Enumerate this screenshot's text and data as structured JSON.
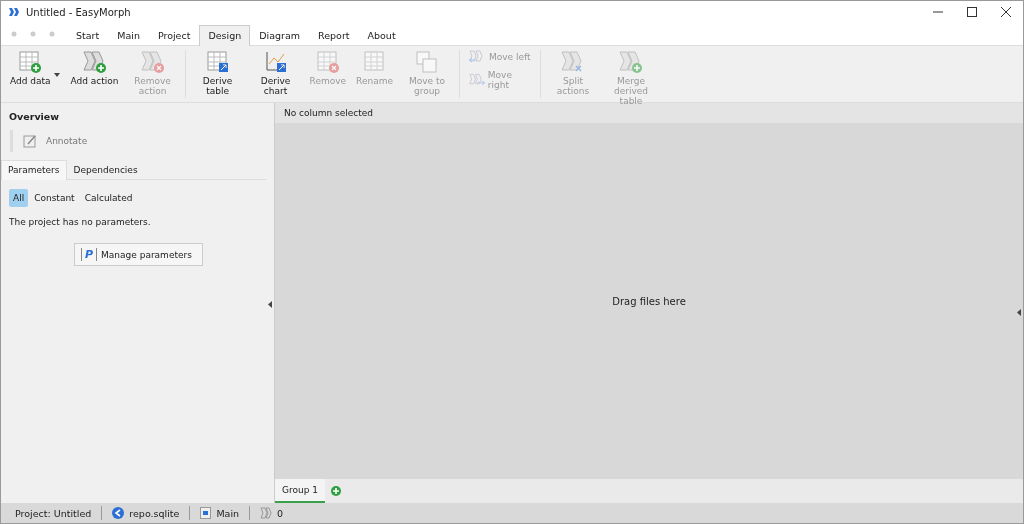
{
  "window": {
    "title": "Untitled - EasyMorph"
  },
  "menu_tabs": [
    {
      "label": "Start",
      "selected": false
    },
    {
      "label": "Main",
      "selected": false
    },
    {
      "label": "Project",
      "selected": false
    },
    {
      "label": "Design",
      "selected": true
    },
    {
      "label": "Diagram",
      "selected": false
    },
    {
      "label": "Report",
      "selected": false
    },
    {
      "label": "About",
      "selected": false
    }
  ],
  "ribbon": [
    {
      "buttons": [
        {
          "kind": "split",
          "label": "Add data",
          "disabled": false
        },
        {
          "kind": "large",
          "label": "Add action",
          "disabled": false
        },
        {
          "kind": "large",
          "label": "Remove action",
          "disabled": true
        }
      ]
    },
    {
      "buttons": [
        {
          "kind": "large",
          "label": "Derive table",
          "disabled": false
        },
        {
          "kind": "large",
          "label": "Derive chart",
          "disabled": false
        },
        {
          "kind": "large",
          "label": "Remove",
          "disabled": true
        },
        {
          "kind": "large",
          "label": "Rename",
          "disabled": true
        },
        {
          "kind": "large",
          "label": "Move to group",
          "disabled": true
        }
      ]
    },
    {
      "buttons": [
        {
          "kind": "small",
          "label": "Move left",
          "disabled": true
        },
        {
          "kind": "small",
          "label": "Move right",
          "disabled": true
        }
      ]
    },
    {
      "buttons": [
        {
          "kind": "large",
          "label": "Split actions",
          "disabled": true
        },
        {
          "kind": "large",
          "label": "Merge derived table",
          "disabled": true
        }
      ]
    }
  ],
  "overview": {
    "title": "Overview",
    "annotate": "Annotate"
  },
  "parameter_tabs": [
    {
      "label": "Parameters",
      "selected": true
    },
    {
      "label": "Dependencies",
      "selected": false
    }
  ],
  "filters": [
    {
      "label": "All",
      "selected": true
    },
    {
      "label": "Constant",
      "selected": false
    },
    {
      "label": "Calculated",
      "selected": false
    }
  ],
  "empty_message": "The project has no parameters.",
  "manage_button": {
    "icon_letter": "P",
    "label": "Manage parameters"
  },
  "column_header": "No column selected",
  "drop_hint": "Drag files here",
  "group_tabs": [
    {
      "label": "Group 1",
      "selected": true
    }
  ],
  "status_bar": [
    {
      "kind": "project",
      "text": "Project: Untitled"
    },
    {
      "kind": "repo",
      "text": "repo.sqlite"
    },
    {
      "kind": "module",
      "text": "Main"
    },
    {
      "kind": "actions",
      "text": "0"
    }
  ]
}
